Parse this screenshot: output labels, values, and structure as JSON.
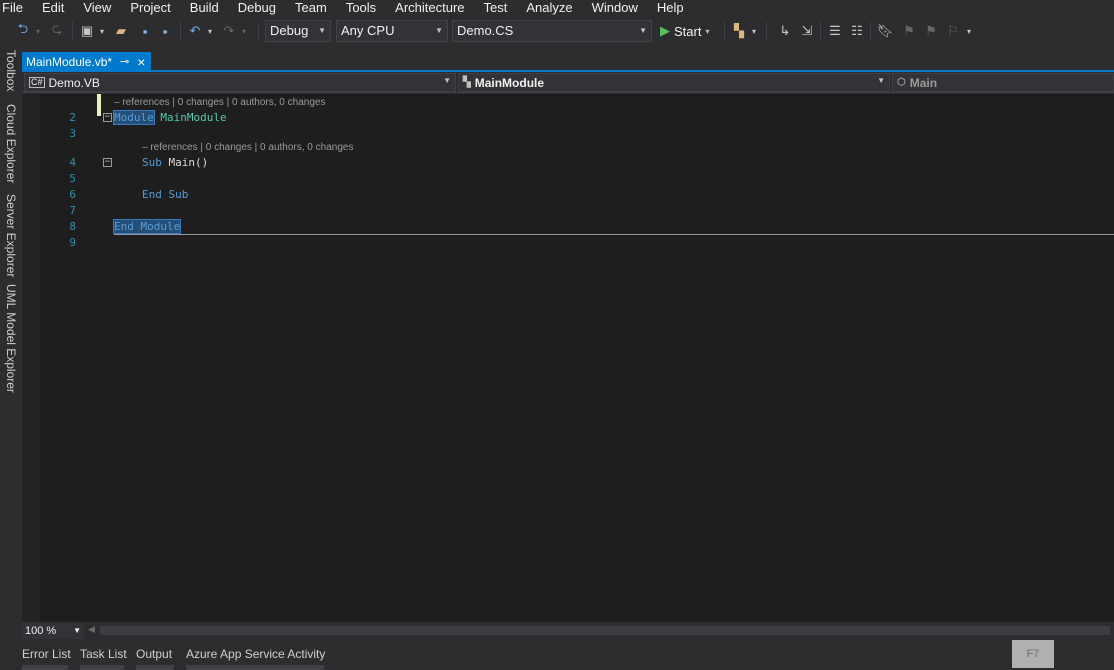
{
  "menu": [
    "File",
    "Edit",
    "View",
    "Project",
    "Build",
    "Debug",
    "Team",
    "Tools",
    "Architecture",
    "Test",
    "Analyze",
    "Window",
    "Help"
  ],
  "toolbar": {
    "configuration": "Debug",
    "platform": "Any CPU",
    "startup_project": "Demo.CS",
    "start_label": "Start"
  },
  "side_tabs": [
    "Toolbox",
    "Cloud Explorer",
    "Server Explorer",
    "UML Model Explorer"
  ],
  "document_tab": {
    "title": "MainModule.vb*"
  },
  "navbar": {
    "project": "Demo.VB",
    "type": "MainModule",
    "member": "Main"
  },
  "editor": {
    "lens_module": "– references | 0 changes | 0 authors, 0 changes",
    "lens_sub": "– references | 0 changes | 0 authors, 0 changes",
    "lines": [
      {
        "no": "2",
        "kw": "Module",
        "rest": " MainModule"
      },
      {
        "no": "3"
      },
      {
        "no": "4",
        "kw": "Sub",
        "rest": " Main()"
      },
      {
        "no": "5"
      },
      {
        "no": "6",
        "kw": "End Sub"
      },
      {
        "no": "7"
      },
      {
        "no": "8",
        "kw": "End Module"
      },
      {
        "no": "9"
      }
    ]
  },
  "zoom": "100 %",
  "bottom_tabs": [
    "Error List",
    "Task List",
    "Output",
    "Azure App Service Activity"
  ],
  "shortcut_badge": "F7",
  "colors": {
    "accent": "#007acc",
    "keyword": "#569cd6",
    "line_number": "#2b91af",
    "editor_bg": "#1e1e1e"
  }
}
